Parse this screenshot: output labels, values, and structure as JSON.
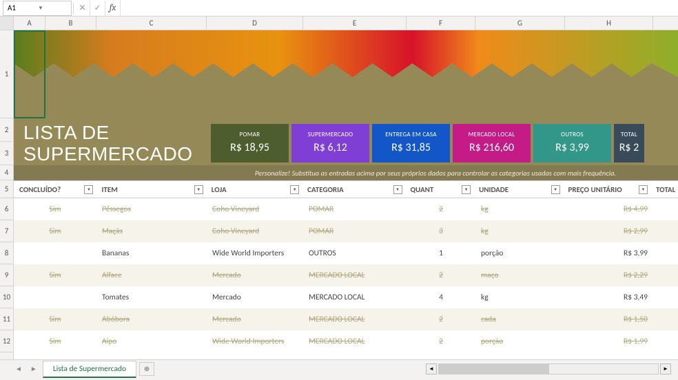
{
  "formula_bar": {
    "cell_ref": "A1",
    "formula": ""
  },
  "columns": [
    "A",
    "B",
    "C",
    "D",
    "E",
    "F",
    "G",
    "H"
  ],
  "row_numbers": [
    1,
    2,
    3,
    4,
    5,
    6,
    7,
    8,
    9,
    10,
    11,
    12
  ],
  "title_line1": "LISTA DE",
  "title_line2": "SUPERMERCADO",
  "cards": [
    {
      "label": "POMAR",
      "value": "R$ 18,95",
      "cls": "c1"
    },
    {
      "label": "SUPERMERCADO",
      "value": "R$ 6,12",
      "cls": "c2"
    },
    {
      "label": "ENTREGA EM CASA",
      "value": "R$ 31,85",
      "cls": "c3"
    },
    {
      "label": "MERCADO LOCAL",
      "value": "R$ 216,60",
      "cls": "c4"
    },
    {
      "label": "OUTROS",
      "value": "R$ 3,99",
      "cls": "c5"
    },
    {
      "label": "TOTAL",
      "value": "R$ 2",
      "cls": "c6"
    }
  ],
  "hint": "Personalize! Substitua as entradas acima por seus próprios dados para controlar as categorias usadas com mais frequência.",
  "headers": {
    "concluido": "CONCLUÍDO?",
    "item": "ITEM",
    "loja": "LOJA",
    "categoria": "CATEGORIA",
    "quant": "QUANT",
    "unidade": "UNIDADE",
    "preco": "PREÇO UNITÁRIO",
    "total": "TOTAL"
  },
  "rows": [
    {
      "done": "Sim",
      "item": "Pêssegos",
      "loja": "Coho Vineyard",
      "cat": "POMAR",
      "qt": "2",
      "un": "kg",
      "preco": "R$ 4,99",
      "completed": true
    },
    {
      "done": "Sim",
      "item": "Maçãs",
      "loja": "Coho Vineyard",
      "cat": "POMAR",
      "qt": "3",
      "un": "kg",
      "preco": "R$ 2,99",
      "completed": true
    },
    {
      "done": "",
      "item": "Bananas",
      "loja": "Wide World Importers",
      "cat": "OUTROS",
      "qt": "1",
      "un": "porção",
      "preco": "R$ 3,99",
      "completed": false
    },
    {
      "done": "Sim",
      "item": "Alface",
      "loja": "Mercado",
      "cat": "MERCADO LOCAL",
      "qt": "2",
      "un": "maço",
      "preco": "R$ 2,29",
      "completed": true
    },
    {
      "done": "",
      "item": "Tomates",
      "loja": "Mercado",
      "cat": "MERCADO LOCAL",
      "qt": "4",
      "un": "kg",
      "preco": "R$ 3,49",
      "completed": false
    },
    {
      "done": "Sim",
      "item": "Abóbora",
      "loja": "Mercado",
      "cat": "MERCADO LOCAL",
      "qt": "2",
      "un": "cada",
      "preco": "R$ 1,50",
      "completed": true
    },
    {
      "done": "Sim",
      "item": "Aipo",
      "loja": "Wide World Importers",
      "cat": "MERCADO LOCAL",
      "qt": "2",
      "un": "porção",
      "preco": "R$ 1,99",
      "completed": true
    }
  ],
  "sheet_tab": "Lista de Supermercado",
  "chart_data": {
    "type": "table",
    "title": "LISTA DE SUPERMERCADO",
    "category_totals": {
      "POMAR": 18.95,
      "SUPERMERCADO": 6.12,
      "ENTREGA EM CASA": 31.85,
      "MERCADO LOCAL": 216.6,
      "OUTROS": 3.99
    },
    "columns": [
      "CONCLUÍDO?",
      "ITEM",
      "LOJA",
      "CATEGORIA",
      "QUANT",
      "UNIDADE",
      "PREÇO UNITÁRIO"
    ],
    "rows": [
      [
        "Sim",
        "Pêssegos",
        "Coho Vineyard",
        "POMAR",
        2,
        "kg",
        4.99
      ],
      [
        "Sim",
        "Maçãs",
        "Coho Vineyard",
        "POMAR",
        3,
        "kg",
        2.99
      ],
      [
        "",
        "Bananas",
        "Wide World Importers",
        "OUTROS",
        1,
        "porção",
        3.99
      ],
      [
        "Sim",
        "Alface",
        "Mercado",
        "MERCADO LOCAL",
        2,
        "maço",
        2.29
      ],
      [
        "",
        "Tomates",
        "Mercado",
        "MERCADO LOCAL",
        4,
        "kg",
        3.49
      ],
      [
        "Sim",
        "Abóbora",
        "Mercado",
        "MERCADO LOCAL",
        2,
        "cada",
        1.5
      ],
      [
        "Sim",
        "Aipo",
        "Wide World Importers",
        "MERCADO LOCAL",
        2,
        "porção",
        1.99
      ]
    ]
  }
}
